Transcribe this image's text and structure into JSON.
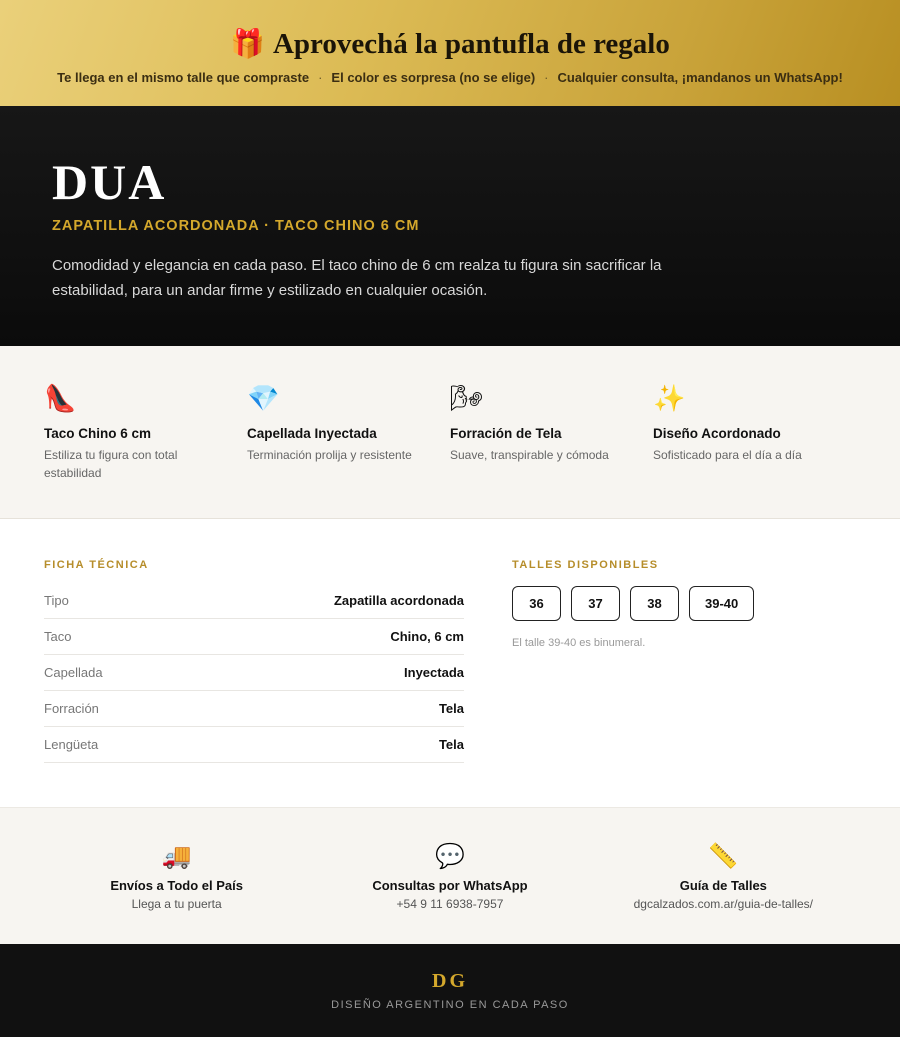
{
  "promo": {
    "icon": "gift-icon",
    "icon_glyph": "🎁",
    "title": "Aprovechá la pantufla de regalo",
    "items": [
      "Te llega en el mismo talle que compraste",
      "El color es sorpresa (no se elige)",
      "Cualquier consulta, ¡mandanos un WhatsApp!"
    ],
    "separator": "·"
  },
  "hero": {
    "title": "DUA",
    "subtitle": "ZAPATILLA ACORDONADA · TACO CHINO 6 CM",
    "description": "Comodidad y elegancia en cada paso. El taco chino de 6 cm realza tu figura sin sacrificar la estabilidad, para un andar firme y estilizado en cualquier ocasión."
  },
  "features": [
    {
      "icon": "high-heel-icon",
      "glyph": "👠",
      "title": "Taco Chino 6 cm",
      "desc": "Estiliza tu figura con total estabilidad"
    },
    {
      "icon": "gem-icon",
      "glyph": "💎",
      "title": "Capellada Inyectada",
      "desc": "Terminación prolija y resistente"
    },
    {
      "icon": "wind-icon",
      "glyph": "🌬",
      "title": "Forración de Tela",
      "desc": "Suave, transpirable y cómoda"
    },
    {
      "icon": "sparkles-icon",
      "glyph": "✨",
      "title": "Diseño Acordonado",
      "desc": "Sofisticado para el día a día"
    }
  ],
  "specs": {
    "label": "FICHA TÉCNICA",
    "rows": [
      {
        "key": "Tipo",
        "value": "Zapatilla acordonada"
      },
      {
        "key": "Taco",
        "value": "Chino, 6 cm"
      },
      {
        "key": "Capellada",
        "value": "Inyectada"
      },
      {
        "key": "Forración",
        "value": "Tela"
      },
      {
        "key": "Lengüeta",
        "value": "Tela"
      }
    ]
  },
  "sizes": {
    "label": "TALLES DISPONIBLES",
    "options": [
      "36",
      "37",
      "38",
      "39-40"
    ],
    "note": "El talle 39-40 es binumeral."
  },
  "services": [
    {
      "icon": "truck-icon",
      "glyph": "🚚",
      "title": "Envíos a Todo el País",
      "desc": "Llega a tu puerta"
    },
    {
      "icon": "chat-bubble-icon",
      "glyph": "💬",
      "title": "Consultas por WhatsApp",
      "desc": "+54 9 11 6938-7957"
    },
    {
      "icon": "ruler-icon",
      "glyph": "📏",
      "title": "Guía de Talles",
      "desc": "dgcalzados.com.ar/guia-de-talles/"
    }
  ],
  "footer": {
    "logo": "DG",
    "tagline": "DISEÑO ARGENTINO EN CADA PASO"
  },
  "colors": {
    "accent_gold": "#d4a82c",
    "dark": "#111111",
    "light_bg": "#f7f5f1"
  }
}
